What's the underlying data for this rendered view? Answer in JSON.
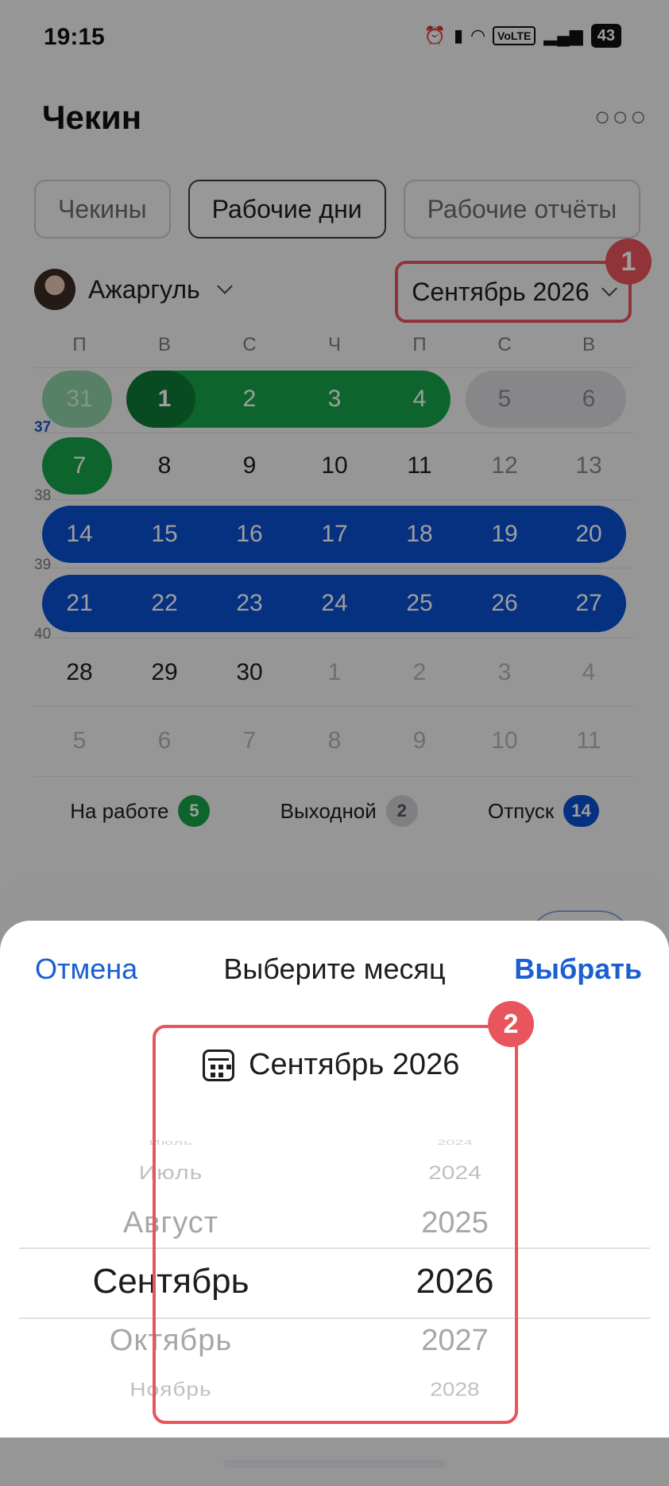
{
  "status_bar": {
    "time": "19:15",
    "volte": "VoLTE",
    "battery": "43"
  },
  "header": {
    "title": "Чекин",
    "more_icon": "ellipsis-icon"
  },
  "tabs": [
    {
      "label": "Чекины",
      "active": false
    },
    {
      "label": "Рабочие дни",
      "active": true
    },
    {
      "label": "Рабочие отчёты",
      "active": false
    }
  ],
  "user": {
    "name": "Ажаргуль"
  },
  "month_selector": {
    "label": "Сентябрь 2026"
  },
  "callouts": [
    "1",
    "2"
  ],
  "calendar": {
    "weekdays": [
      "П",
      "В",
      "С",
      "Ч",
      "П",
      "С",
      "В"
    ],
    "week_numbers": [
      "37",
      "38",
      "39",
      "40"
    ],
    "rows": [
      [
        "31",
        "1",
        "2",
        "3",
        "4",
        "5",
        "6"
      ],
      [
        "7",
        "8",
        "9",
        "10",
        "11",
        "12",
        "13"
      ],
      [
        "14",
        "15",
        "16",
        "17",
        "18",
        "19",
        "20"
      ],
      [
        "21",
        "22",
        "23",
        "24",
        "25",
        "26",
        "27"
      ],
      [
        "28",
        "29",
        "30",
        "1",
        "2",
        "3",
        "4"
      ],
      [
        "5",
        "6",
        "7",
        "8",
        "9",
        "10",
        "11"
      ]
    ]
  },
  "legend": [
    {
      "label": "На работе",
      "count": "5",
      "color": "#16a34a"
    },
    {
      "label": "Выходной",
      "count": "2",
      "color": "#cfcfd3"
    },
    {
      "label": "Отпуск",
      "count": "14",
      "color": "#0a4fd1"
    }
  ],
  "colors": {
    "work": "#16a34a",
    "work_today": "#0f7a36",
    "vacation": "#0a4fd1",
    "dayoff": "#dadadd",
    "accent": "#1a5ed0",
    "callout": "#e8555c"
  },
  "sheet": {
    "cancel": "Отмена",
    "title": "Выберите месяц",
    "choose": "Выбрать",
    "current": "Сентябрь 2026",
    "months": [
      "Июль",
      "Июль",
      "Август",
      "Сентябрь",
      "Октябрь",
      "Ноябрь"
    ],
    "years": [
      "2024",
      "2024",
      "2025",
      "2026",
      "2027",
      "2028"
    ]
  }
}
